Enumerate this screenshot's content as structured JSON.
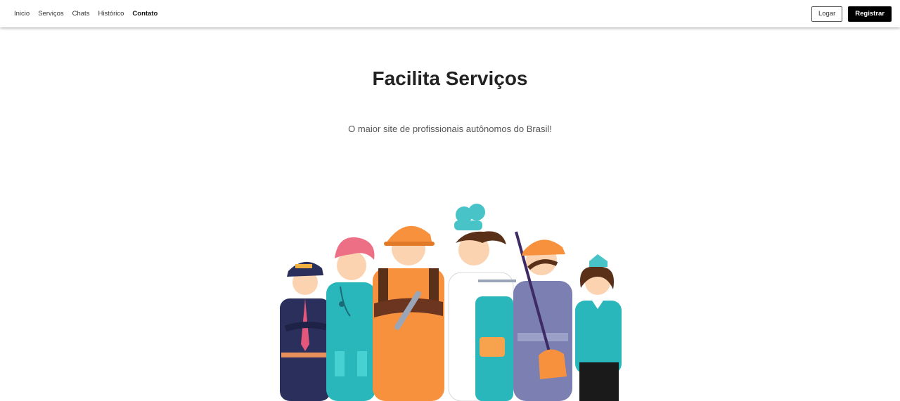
{
  "nav": {
    "links": [
      "Inicio",
      "Serviços",
      "Chats",
      "Histórico",
      "Contato"
    ],
    "login_label": "Logar",
    "register_label": "Registrar"
  },
  "hero": {
    "title": "Facilita Serviços",
    "subtitle": "O maior site de profissionais autônomos do Brasil!"
  },
  "illustration": {
    "icon": "workers-illustration",
    "figures": [
      "police-officer",
      "nurse",
      "mechanic",
      "chef",
      "cleaner",
      "flight-attendant"
    ]
  },
  "colors": {
    "register_bg": "#000000",
    "teal": "#1fb5bf",
    "orange": "#f7913d"
  }
}
